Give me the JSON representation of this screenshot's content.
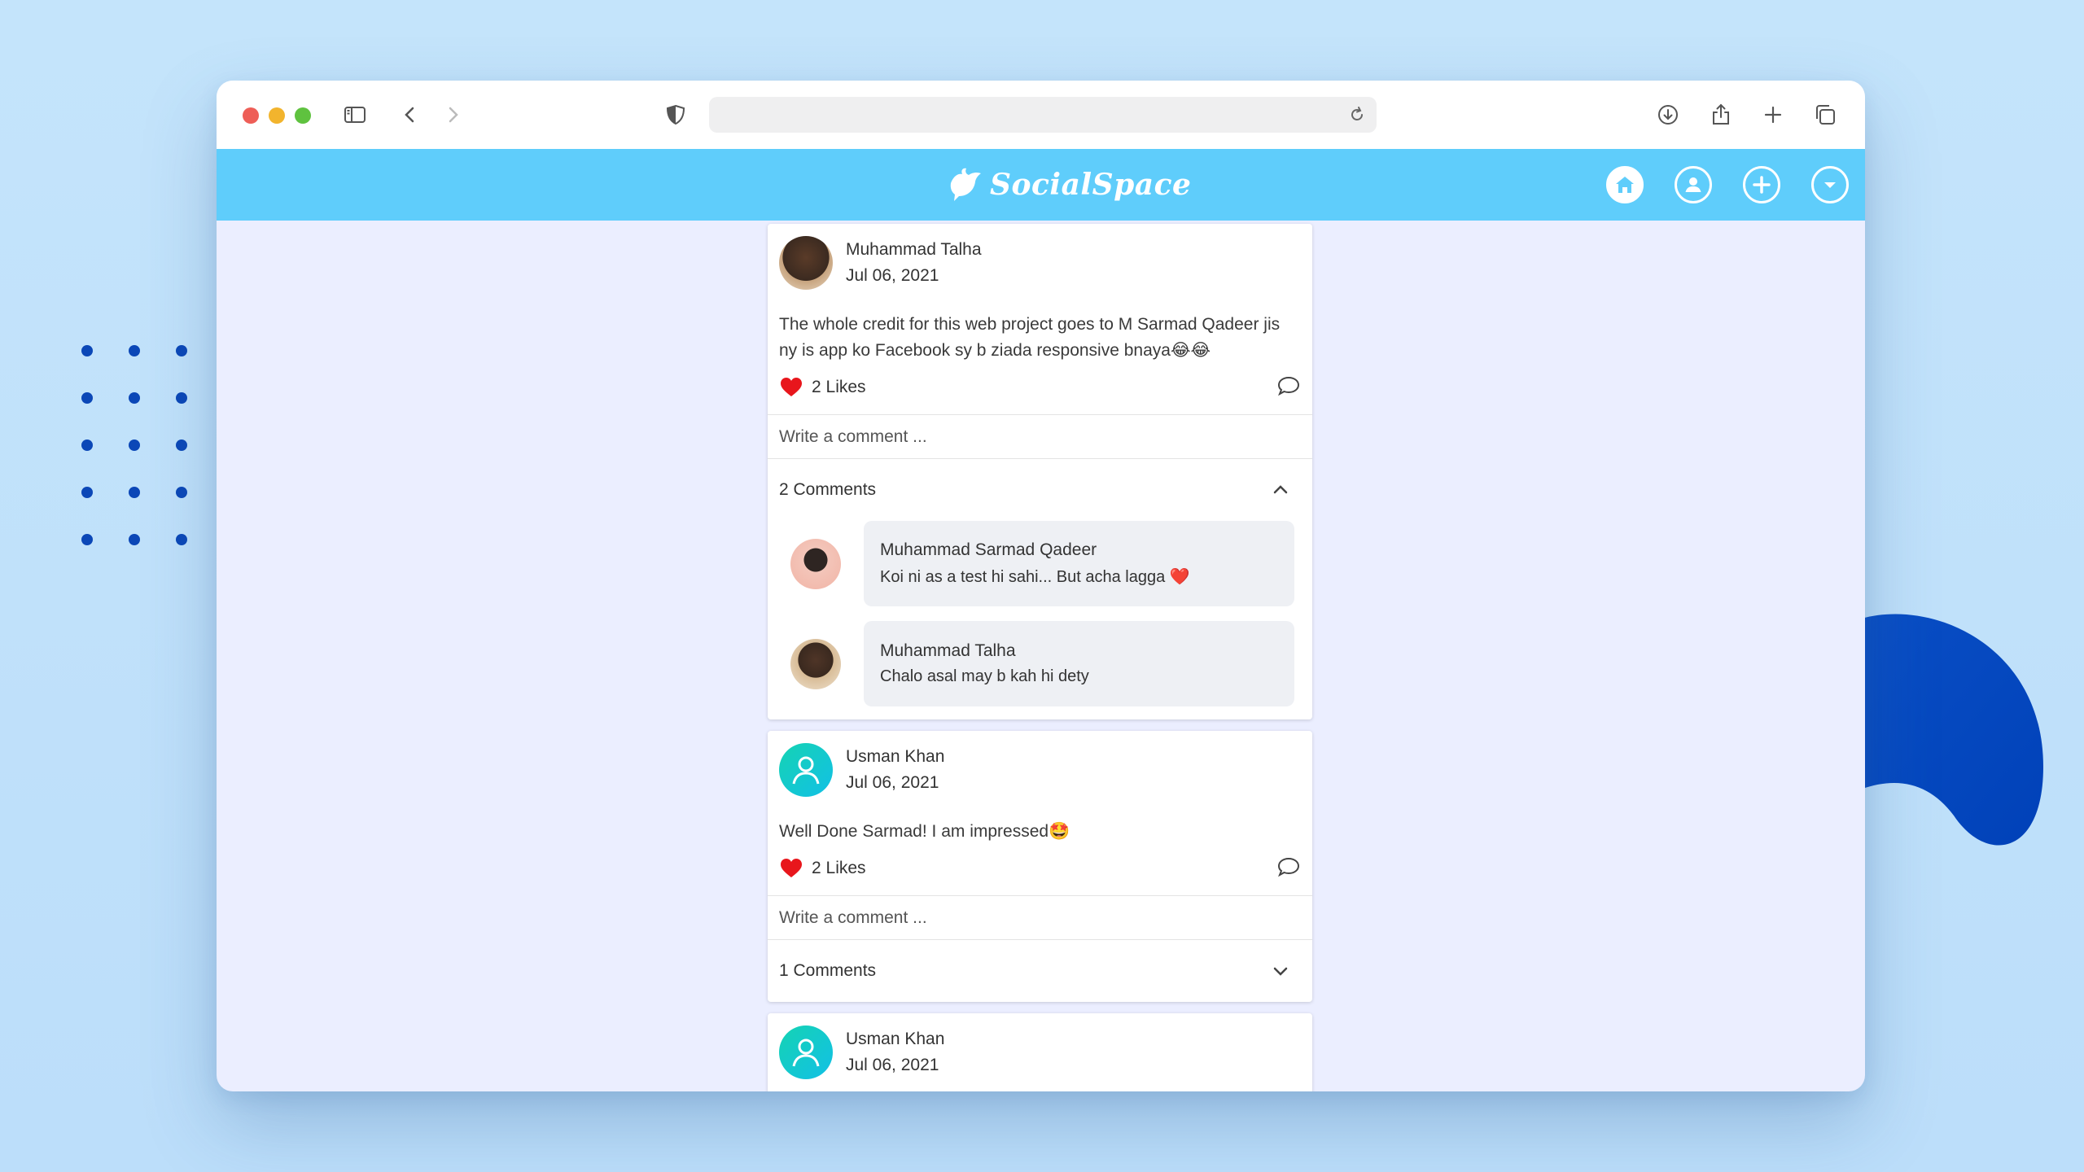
{
  "app": {
    "brand": "SocialSpace",
    "colors": {
      "appbar": "#5fcdfb",
      "background": "#ebeeff",
      "like": "#e8161c",
      "avatar_gradient": [
        "#15d3b3",
        "#12c0e6"
      ]
    }
  },
  "browser": {
    "url": "",
    "icons": [
      "sidebar-icon",
      "back-icon",
      "forward-icon",
      "shield-icon",
      "reload-icon",
      "download-icon",
      "share-icon",
      "new-tab-icon",
      "tabs-overview-icon"
    ]
  },
  "nav": {
    "icons": [
      "home-icon",
      "profile-icon",
      "add-post-icon",
      "dropdown-icon"
    ]
  },
  "posts": [
    {
      "author": "Muhammad Talha",
      "date": "Jul 06, 2021",
      "text": "The whole credit for this web project goes to M Sarmad Qadeer jis ny is app ko Facebook sy b ziada responsive bnaya😂😂",
      "likes": "2 Likes",
      "comment_placeholder": "Write a comment ...",
      "comments_label": "2 Comments",
      "comments_expanded": true,
      "comments": [
        {
          "author": "Muhammad Sarmad Qadeer",
          "text": "Koi ni as a test hi sahi... But acha lagga ❤️"
        },
        {
          "author": "Muhammad Talha",
          "text": "Chalo asal may b kah hi dety"
        }
      ]
    },
    {
      "author": "Usman Khan",
      "date": "Jul 06, 2021",
      "text": "Well Done Sarmad! I am impressed🤩",
      "likes": "2 Likes",
      "comment_placeholder": "Write a comment ...",
      "comments_label": "1 Comments",
      "comments_expanded": false
    },
    {
      "author": "Usman Khan",
      "date": "Jul 06, 2021"
    }
  ]
}
